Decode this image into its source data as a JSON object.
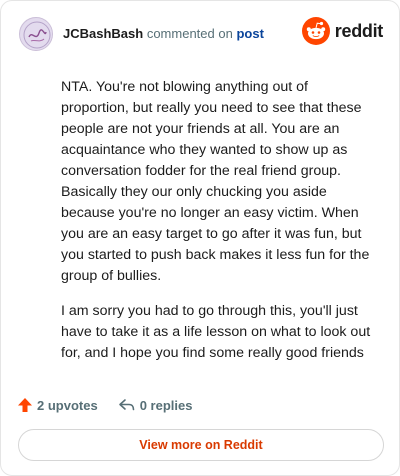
{
  "comment": {
    "username": "JCBashBash",
    "action_text": "commented on",
    "post_link": "post",
    "paragraphs": [
      "NTA. You're not blowing anything out of proportion, but really you need to see that these people are not your friends at all. You are an acquaintance who they wanted to show up as conversation fodder for the real friend group. Basically they our only chucking you aside because you're no longer an easy victim. When you are an easy target to go after it was fun, but you started to push back makes it less fun for the group of bullies.",
      "I am sorry you had to go through this, you'll just have to take it as a life lesson on what to look out for, and I hope you find some really good friends"
    ]
  },
  "brand": {
    "name": "reddit",
    "color": "#ff4500"
  },
  "actions": {
    "upvotes": "2 upvotes",
    "replies": "0 replies"
  },
  "footer": {
    "view_more": "View more on Reddit"
  },
  "colors": {
    "accent": "#d93a00",
    "upvote": "#ff4500",
    "link": "#0a449b"
  }
}
